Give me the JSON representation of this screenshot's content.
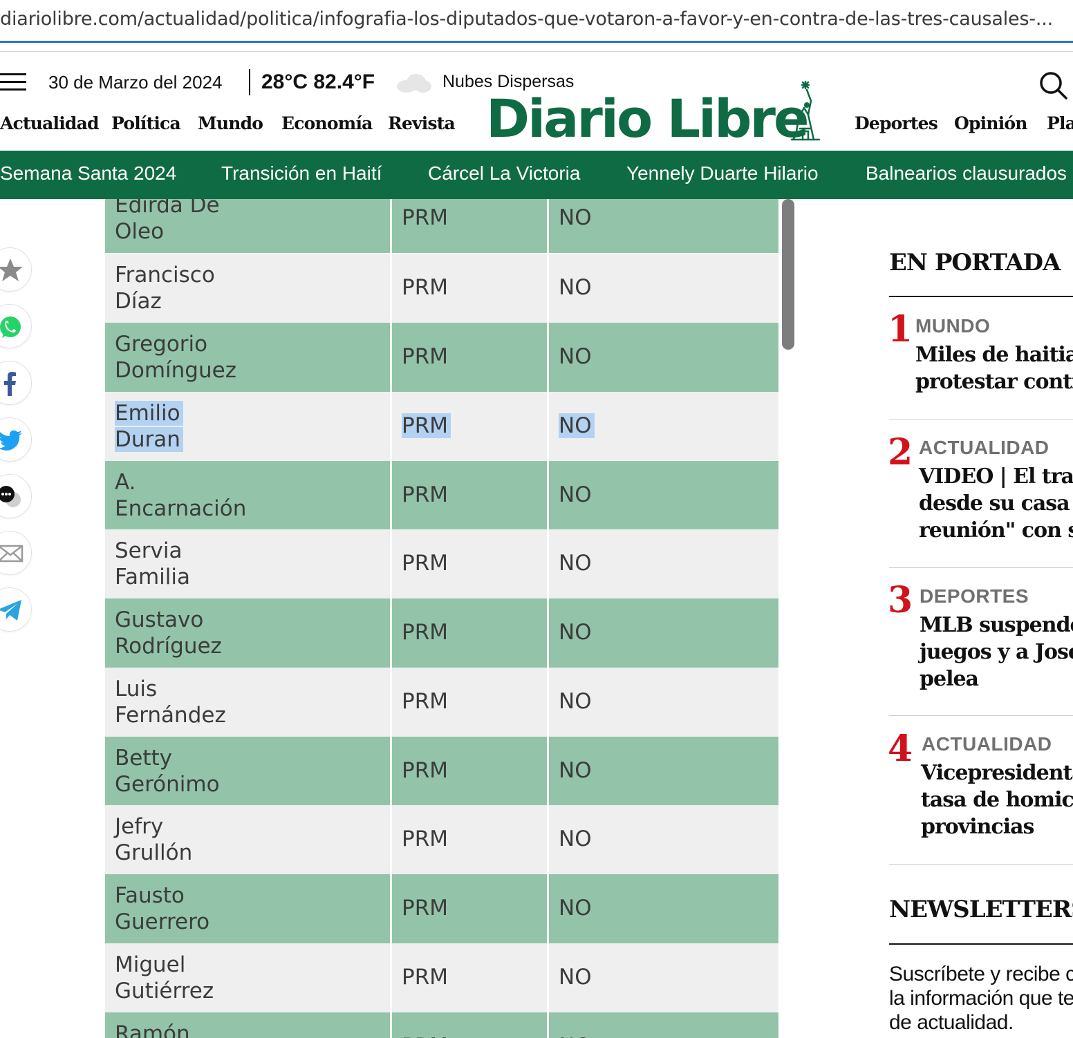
{
  "browser": {
    "url": "diariolibre.com/actualidad/politica/infografia-los-diputados-que-votaron-a-favor-y-en-contra-de-las-tres-causales-..."
  },
  "header": {
    "date": "30 de Marzo del 2024",
    "temperature": "28°C 82.4°F",
    "weather": "Nubes Dispersas",
    "logo": "Diario Libre",
    "logo_color": "#0f6b43",
    "nav_left": [
      "Actualidad",
      "Política",
      "Mundo",
      "Economía",
      "Revista"
    ],
    "nav_right": [
      "Deportes",
      "Opinión",
      "Pla"
    ]
  },
  "trending": {
    "background": "#0f6b43",
    "items": [
      "Semana Santa 2024",
      "Transición en Haití",
      "Cárcel La Victoria",
      "Yennely Duarte Hilario",
      "Balnearios clausurados"
    ]
  },
  "share_icons": [
    "star-icon",
    "whatsapp-icon",
    "facebook-icon",
    "twitter-icon",
    "comments-icon",
    "email-icon",
    "telegram-icon"
  ],
  "table": {
    "row_colors": {
      "green": "#93c4a9",
      "grey": "#efefef"
    },
    "rows": [
      {
        "name": [
          "Edirda De",
          "Oleo"
        ],
        "party": "PRM",
        "vote": "NO"
      },
      {
        "name": [
          "Francisco",
          "Díaz"
        ],
        "party": "PRM",
        "vote": "NO"
      },
      {
        "name": [
          "Gregorio",
          "Domínguez"
        ],
        "party": "PRM",
        "vote": "NO"
      },
      {
        "name": [
          "Emilio",
          "Duran"
        ],
        "party": "PRM",
        "vote": "NO"
      },
      {
        "name": [
          "A.",
          "Encarnación"
        ],
        "party": "PRM",
        "vote": "NO"
      },
      {
        "name": [
          "Servia",
          "Familia"
        ],
        "party": "PRM",
        "vote": "NO"
      },
      {
        "name": [
          "Gustavo",
          "Rodríguez"
        ],
        "party": "PRM",
        "vote": "NO"
      },
      {
        "name": [
          "Luis",
          "Fernández"
        ],
        "party": "PRM",
        "vote": "NO"
      },
      {
        "name": [
          "Betty",
          "Gerónimo"
        ],
        "party": "PRM",
        "vote": "NO"
      },
      {
        "name": [
          "Jefry",
          "Grullón"
        ],
        "party": "PRM",
        "vote": "NO"
      },
      {
        "name": [
          "Fausto",
          "Guerrero"
        ],
        "party": "PRM",
        "vote": "NO"
      },
      {
        "name": [
          "Miguel",
          "Gutiérrez"
        ],
        "party": "PRM",
        "vote": "NO"
      },
      {
        "name": [
          "Ramón Bueno",
          ""
        ],
        "party": "PRM",
        "vote": "NO"
      }
    ]
  },
  "portada": {
    "title": "EN PORTADA",
    "items": [
      {
        "num": "1",
        "category": "MUNDO",
        "lines": [
          "Miles de haitian",
          "protestar contra"
        ]
      },
      {
        "num": "2",
        "category": "ACTUALIDAD",
        "lines": [
          "VIDEO | El traye",
          "desde su casa ha",
          "reunión\" con su"
        ]
      },
      {
        "num": "3",
        "category": "DEPORTES",
        "lines": [
          "MLB suspende a",
          "juegos y a José I",
          "pelea"
        ]
      },
      {
        "num": "4",
        "category": "ACTUALIDAD",
        "lines": [
          "Vicepresidenta",
          "tasa de homicid",
          "provincias"
        ]
      }
    ]
  },
  "newsletters": {
    "title": "NEWSLETTERS",
    "lines": [
      "Suscríbete y recibe c",
      "la información que te",
      "de actualidad."
    ]
  }
}
